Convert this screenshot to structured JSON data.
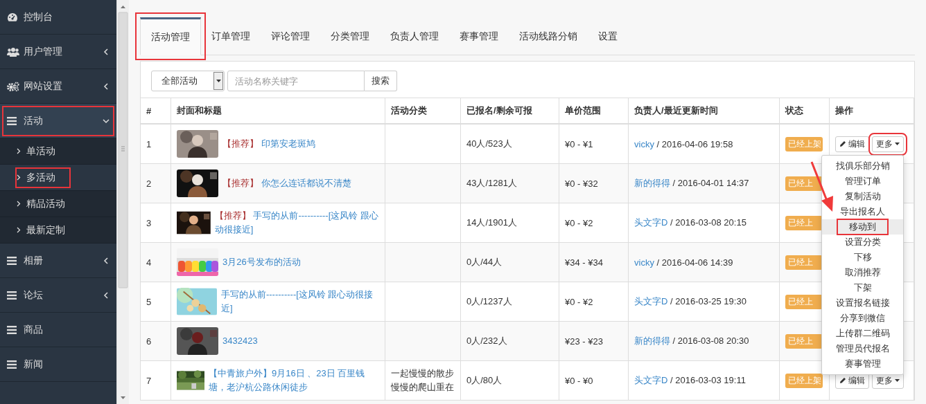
{
  "sidebar": {
    "items": [
      {
        "label": "控制台",
        "expandable": false,
        "selected": false,
        "highlighted": false
      },
      {
        "label": "用户管理",
        "expandable": true,
        "expanded": false,
        "selected": false,
        "highlighted": false
      },
      {
        "label": "网站设置",
        "expandable": true,
        "expanded": false,
        "selected": false,
        "highlighted": false
      },
      {
        "label": "活动",
        "expandable": true,
        "expanded": true,
        "selected": true,
        "highlighted": true,
        "children": [
          {
            "label": "单活动",
            "selected": false,
            "highlighted": false
          },
          {
            "label": "多活动",
            "selected": true,
            "highlighted": true
          },
          {
            "label": "精品活动",
            "selected": false,
            "highlighted": false
          },
          {
            "label": "最新定制",
            "selected": false,
            "highlighted": false
          }
        ]
      },
      {
        "label": "相册",
        "expandable": true,
        "expanded": false,
        "selected": false,
        "highlighted": false
      },
      {
        "label": "论坛",
        "expandable": true,
        "expanded": false,
        "selected": false,
        "highlighted": false
      },
      {
        "label": "商品",
        "expandable": false,
        "selected": false,
        "highlighted": false
      },
      {
        "label": "新闻",
        "expandable": false,
        "selected": false,
        "highlighted": false
      }
    ]
  },
  "tabs": [
    {
      "label": "活动管理",
      "selected": true,
      "highlighted": true
    },
    {
      "label": "订单管理",
      "selected": false,
      "highlighted": false
    },
    {
      "label": "评论管理",
      "selected": false,
      "highlighted": false
    },
    {
      "label": "分类管理",
      "selected": false,
      "highlighted": false
    },
    {
      "label": "负责人管理",
      "selected": false,
      "highlighted": false
    },
    {
      "label": "赛事管理",
      "selected": false,
      "highlighted": false
    },
    {
      "label": "活动线路分销",
      "selected": false,
      "highlighted": false
    },
    {
      "label": "设置",
      "selected": false,
      "highlighted": false
    }
  ],
  "filter": {
    "category": "全部活动",
    "search": {
      "placeholder": "活动名称关键字"
    },
    "search_button": "搜索"
  },
  "table": {
    "columns": [
      "#",
      "封面和标题",
      "活动分类",
      "已报名/剩余可报",
      "单价范围",
      "负责人/最近更新时间",
      "状态",
      "操作"
    ],
    "rows": [
      {
        "index": "1",
        "tag": "【推荐】",
        "title": "印第安老斑鸠",
        "registered": "40人/523人",
        "price": "¥0 - ¥1",
        "owner": "vicky",
        "updated": " / 2016-04-06 19:58",
        "status": "已经上架",
        "actions": [
          {
            "label": "编辑",
            "kind": "edit",
            "highlighted": false
          },
          {
            "label": "更多",
            "kind": "more",
            "highlighted": true
          }
        ]
      },
      {
        "index": "2",
        "tag": "【推荐】",
        "title": "你怎么连话都说不清楚",
        "registered": "43人/1281人",
        "price": "¥0 - ¥32",
        "owner": "新的得得",
        "updated": " / 2016-04-01 14:37",
        "status": "已经上"
      },
      {
        "index": "3",
        "tag": "【推荐】",
        "title": "手写的从前----------[这风铃 跟心动很接近]",
        "registered": "14人/1901人",
        "price": "¥0 - ¥2",
        "owner": "头文字D",
        "updated": " / 2016-03-08 20:15",
        "status": "已经上"
      },
      {
        "index": "4",
        "title": "3月26号发布的活动",
        "registered": "0人/44人",
        "price": "¥34 - ¥34",
        "owner": "vicky",
        "updated": " / 2016-04-06 14:39",
        "status": "已经上"
      },
      {
        "index": "5",
        "title": "手写的从前----------[这风铃 跟心动很接近]",
        "registered": "0人/1237人",
        "price": "¥0 - ¥2",
        "owner": "头文字D",
        "updated": " / 2016-03-25 19:30",
        "status": "已经上"
      },
      {
        "index": "6",
        "title": "3432423",
        "registered": "0人/232人",
        "price": "¥23 - ¥23",
        "owner": "新的得得",
        "updated": " / 2016-03-08 20:30",
        "status": "已经上"
      },
      {
        "index": "7",
        "title": "【中青旅户外】9月16日 、23日 百里钱塘，老沪杭公路休闲徒步",
        "category": "一起慢慢的散步慢慢的爬山重在",
        "registered": "0人/80人",
        "price": "¥0 - ¥0",
        "owner": "头文字D",
        "updated": " / 2016-03-03 19:11",
        "status": "已经上架",
        "actions": [
          {
            "label": "编辑",
            "kind": "edit",
            "highlighted": false
          },
          {
            "label": "更多",
            "kind": "more",
            "highlighted": false
          }
        ]
      }
    ]
  },
  "more_menu": {
    "arrow": true,
    "items": [
      {
        "label": "找俱乐部分销",
        "selected": false,
        "highlighted": false
      },
      {
        "label": "管理订单",
        "selected": false,
        "highlighted": false
      },
      {
        "label": "复制活动",
        "selected": false,
        "highlighted": false
      },
      {
        "label": "导出报名人",
        "selected": false,
        "highlighted": false
      },
      {
        "label": "移动到",
        "selected": true,
        "highlighted": true
      },
      {
        "label": "设置分类",
        "selected": false,
        "highlighted": false
      },
      {
        "label": "下移",
        "selected": false,
        "highlighted": false
      },
      {
        "label": "取消推荐",
        "selected": false,
        "highlighted": false
      },
      {
        "label": "下架",
        "selected": false,
        "highlighted": false
      },
      {
        "label": "设置报名链接",
        "selected": false,
        "highlighted": false
      },
      {
        "label": "分享到微信",
        "selected": false,
        "highlighted": false
      },
      {
        "label": "上传群二维码",
        "selected": false,
        "highlighted": false
      },
      {
        "label": "管理员代报名",
        "selected": false,
        "highlighted": false
      },
      {
        "label": "赛事管理",
        "selected": false,
        "highlighted": false
      }
    ]
  }
}
